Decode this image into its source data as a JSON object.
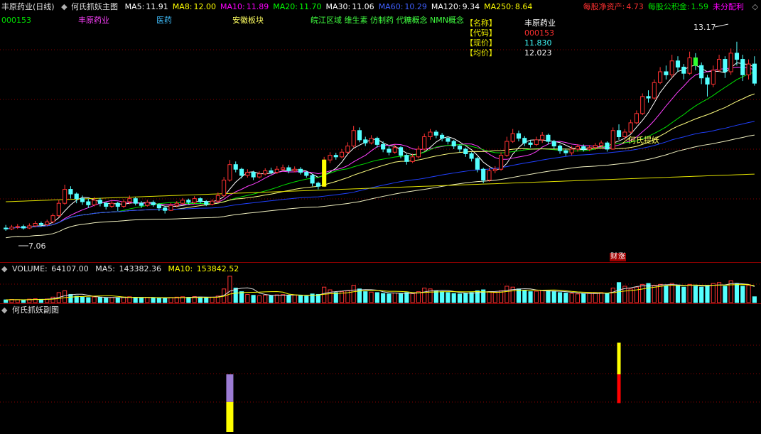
{
  "header": {
    "title": "丰原药业(日线)",
    "indicator_name": "何氏抓妖主图",
    "ma": [
      {
        "label": "MA5:",
        "value": "11.91",
        "color": "#ffffff"
      },
      {
        "label": "MA8:",
        "value": "12.00",
        "color": "#ffff00"
      },
      {
        "label": "MA10:",
        "value": "11.89",
        "color": "#ff00ff"
      },
      {
        "label": "MA20:",
        "value": "11.70",
        "color": "#00ff00"
      },
      {
        "label": "MA30:",
        "value": "11.06",
        "color": "#ffffff"
      },
      {
        "label": "MA60:",
        "value": "10.29",
        "color": "#4060ff"
      },
      {
        "label": "MA120:",
        "value": "9.34",
        "color": "#ffffff"
      },
      {
        "label": "MA250:",
        "value": "8.64",
        "color": "#ffff00"
      }
    ],
    "right": [
      {
        "label": "每股净资产:",
        "value": "4.73",
        "label_color": "#ff3030",
        "value_color": "#ff3030"
      },
      {
        "label": "每股公积金:",
        "value": "1.59",
        "label_color": "#00e000",
        "value_color": "#00e000"
      },
      {
        "label": "未分配利",
        "value": "",
        "label_color": "#ff00ff",
        "value_color": "#ff00ff"
      }
    ]
  },
  "subheader": {
    "code": "000153",
    "name": "丰原药业",
    "industry": "医药",
    "region": "安徽板块",
    "concepts": "皖江区域 维生素 仿制药 代糖概念 NMN概念"
  },
  "info_panel": [
    {
      "key": "【名称】",
      "value": "丰原药业",
      "color": "#ffffff"
    },
    {
      "key": "【代码】",
      "value": "000153",
      "color": "#ff3030"
    },
    {
      "key": "【现价】",
      "value": "11.830",
      "color": "#40ffff"
    },
    {
      "key": "【均价】",
      "value": "12.023",
      "color": "#ffffff"
    }
  ],
  "annotations": {
    "high_price": "13.17",
    "low_price": "7.06",
    "signal_text": "何氏提妖",
    "badge_cai": "财",
    "badge_zhang": "涨"
  },
  "volume_panel": {
    "title": "VOLUME:",
    "volume": "64107.00",
    "ma5_label": "MA5:",
    "ma5": "143382.36",
    "ma10_label": "MA10:",
    "ma10": "153842.52"
  },
  "sub_panel": {
    "title": "何氏抓妖副图"
  },
  "colors": {
    "up": "#ff3232",
    "down": "#54ffff",
    "background": "#000000",
    "grid": "#8b0000"
  },
  "chart_data": {
    "type": "candlestick",
    "price_range": [
      6.6,
      13.6
    ],
    "candles": [
      [
        7.15,
        7.12,
        7.25,
        7.06
      ],
      [
        7.12,
        7.18,
        7.25,
        7.08
      ],
      [
        7.18,
        7.2,
        7.28,
        7.12
      ],
      [
        7.2,
        7.15,
        7.26,
        7.1
      ],
      [
        7.15,
        7.22,
        7.3,
        7.12
      ],
      [
        7.22,
        7.3,
        7.38,
        7.18
      ],
      [
        7.3,
        7.26,
        7.36,
        7.2
      ],
      [
        7.26,
        7.35,
        7.42,
        7.22
      ],
      [
        7.35,
        7.55,
        7.62,
        7.3
      ],
      [
        7.55,
        7.95,
        8.05,
        7.5
      ],
      [
        7.95,
        8.4,
        8.55,
        7.9
      ],
      [
        8.4,
        8.25,
        8.5,
        8.1
      ],
      [
        8.25,
        8.1,
        8.3,
        7.95
      ],
      [
        8.1,
        8.0,
        8.2,
        7.9
      ],
      [
        8.0,
        7.9,
        8.1,
        7.8
      ],
      [
        7.9,
        8.05,
        8.15,
        7.85
      ],
      [
        8.05,
        7.95,
        8.12,
        7.85
      ],
      [
        7.95,
        7.85,
        8.0,
        7.75
      ],
      [
        7.85,
        7.95,
        8.05,
        7.8
      ],
      [
        7.95,
        7.85,
        8.0,
        7.7
      ],
      [
        7.85,
        8.0,
        8.08,
        7.8
      ],
      [
        8.0,
        8.1,
        8.2,
        7.92
      ],
      [
        8.1,
        7.95,
        8.15,
        7.88
      ],
      [
        7.95,
        7.88,
        8.02,
        7.8
      ],
      [
        7.88,
        7.98,
        8.06,
        7.84
      ],
      [
        7.98,
        7.9,
        8.04,
        7.84
      ],
      [
        7.9,
        7.8,
        7.95,
        7.7
      ],
      [
        7.8,
        7.72,
        7.85,
        7.62
      ],
      [
        7.72,
        7.88,
        7.96,
        7.7
      ],
      [
        7.88,
        7.95,
        8.02,
        7.82
      ],
      [
        7.95,
        8.05,
        8.12,
        7.9
      ],
      [
        8.05,
        7.98,
        8.1,
        7.9
      ],
      [
        7.98,
        8.1,
        8.18,
        7.92
      ],
      [
        8.1,
        8.0,
        8.15,
        7.94
      ],
      [
        8.0,
        7.92,
        8.05,
        7.86
      ],
      [
        7.92,
        8.02,
        8.08,
        7.88
      ],
      [
        8.02,
        8.2,
        8.3,
        7.98
      ],
      [
        8.2,
        8.7,
        8.8,
        8.15
      ],
      [
        8.7,
        9.2,
        9.35,
        8.65
      ],
      [
        9.2,
        9.05,
        9.3,
        8.95
      ],
      [
        9.05,
        8.85,
        9.1,
        8.75
      ],
      [
        8.85,
        8.95,
        9.05,
        8.78
      ],
      [
        8.95,
        8.8,
        9.0,
        8.7
      ],
      [
        8.8,
        8.9,
        8.98,
        8.75
      ],
      [
        8.9,
        9.0,
        9.08,
        8.85
      ],
      [
        9.0,
        8.95,
        9.1,
        8.88
      ],
      [
        8.95,
        9.05,
        9.15,
        8.9
      ],
      [
        9.05,
        9.1,
        9.2,
        9.0
      ],
      [
        9.1,
        9.0,
        9.18,
        8.92
      ],
      [
        9.0,
        9.05,
        9.14,
        8.95
      ],
      [
        9.05,
        8.95,
        9.12,
        8.88
      ],
      [
        8.95,
        8.85,
        9.0,
        8.78
      ],
      [
        8.85,
        8.6,
        8.9,
        8.5
      ],
      [
        8.6,
        8.5,
        8.65,
        8.4
      ],
      [
        8.5,
        9.35,
        9.45,
        8.48
      ],
      [
        9.35,
        9.5,
        9.6,
        9.25
      ],
      [
        9.5,
        9.45,
        9.58,
        9.36
      ],
      [
        9.45,
        9.6,
        9.7,
        9.4
      ],
      [
        9.6,
        9.8,
        9.92,
        9.55
      ],
      [
        9.8,
        10.3,
        10.45,
        9.75
      ],
      [
        10.3,
        10.0,
        10.4,
        9.92
      ],
      [
        10.0,
        9.9,
        10.1,
        9.8
      ],
      [
        9.9,
        10.05,
        10.15,
        9.85
      ],
      [
        10.05,
        9.85,
        10.1,
        9.75
      ],
      [
        9.85,
        9.7,
        9.95,
        9.6
      ],
      [
        9.7,
        9.6,
        9.8,
        9.5
      ],
      [
        9.6,
        9.75,
        9.85,
        9.55
      ],
      [
        9.75,
        9.5,
        9.8,
        9.4
      ],
      [
        9.5,
        9.3,
        9.55,
        9.2
      ],
      [
        9.3,
        9.45,
        9.55,
        9.25
      ],
      [
        9.45,
        9.7,
        9.8,
        9.4
      ],
      [
        9.7,
        10.1,
        10.2,
        9.65
      ],
      [
        10.1,
        10.25,
        10.35,
        10.0
      ],
      [
        10.25,
        10.15,
        10.32,
        10.05
      ],
      [
        10.15,
        10.05,
        10.22,
        9.95
      ],
      [
        10.05,
        9.95,
        10.1,
        9.85
      ],
      [
        9.95,
        9.8,
        10.0,
        9.7
      ],
      [
        9.8,
        9.7,
        9.85,
        9.6
      ],
      [
        9.7,
        9.55,
        9.75,
        9.45
      ],
      [
        9.55,
        9.4,
        9.6,
        9.3
      ],
      [
        9.4,
        9.05,
        9.45,
        8.95
      ],
      [
        9.05,
        8.7,
        9.1,
        8.6
      ],
      [
        8.7,
        9.0,
        9.1,
        8.65
      ],
      [
        9.0,
        9.05,
        9.15,
        8.92
      ],
      [
        9.05,
        9.5,
        9.6,
        9.0
      ],
      [
        9.5,
        9.95,
        10.1,
        9.45
      ],
      [
        9.95,
        10.2,
        10.35,
        9.9
      ],
      [
        10.2,
        10.05,
        10.3,
        9.95
      ],
      [
        10.05,
        9.9,
        10.12,
        9.8
      ],
      [
        9.9,
        9.85,
        9.98,
        9.75
      ],
      [
        9.85,
        10.0,
        10.1,
        9.8
      ],
      [
        10.0,
        10.15,
        10.25,
        9.9
      ],
      [
        10.15,
        9.95,
        10.2,
        9.85
      ],
      [
        9.95,
        9.8,
        10.0,
        9.7
      ],
      [
        9.8,
        9.65,
        9.85,
        9.55
      ],
      [
        9.65,
        9.58,
        9.72,
        9.48
      ],
      [
        9.58,
        9.7,
        9.8,
        9.5
      ],
      [
        9.7,
        9.78,
        9.86,
        9.62
      ],
      [
        9.78,
        9.7,
        9.85,
        9.62
      ],
      [
        9.7,
        9.75,
        9.83,
        9.64
      ],
      [
        9.75,
        9.82,
        9.9,
        9.68
      ],
      [
        9.82,
        9.9,
        9.98,
        9.75
      ],
      [
        9.9,
        9.7,
        9.95,
        9.62
      ],
      [
        9.7,
        10.3,
        10.4,
        9.68
      ],
      [
        10.3,
        10.1,
        10.5,
        10.0
      ],
      [
        10.1,
        10.25,
        10.35,
        10.0
      ],
      [
        10.25,
        10.55,
        10.65,
        10.2
      ],
      [
        10.55,
        10.85,
        10.95,
        10.5
      ],
      [
        10.85,
        11.4,
        11.5,
        10.8
      ],
      [
        11.4,
        11.35,
        11.6,
        11.2
      ],
      [
        11.35,
        11.85,
        11.95,
        11.3
      ],
      [
        11.85,
        12.2,
        12.35,
        11.8
      ],
      [
        12.2,
        12.1,
        12.4,
        11.95
      ],
      [
        12.1,
        12.55,
        12.75,
        12.0
      ],
      [
        12.55,
        12.35,
        12.7,
        12.2
      ],
      [
        12.35,
        12.15,
        12.45,
        11.95
      ],
      [
        12.15,
        12.65,
        12.85,
        12.1
      ],
      [
        12.65,
        12.4,
        12.8,
        12.25
      ],
      [
        12.4,
        12.0,
        12.5,
        11.8
      ],
      [
        12.0,
        11.8,
        12.1,
        11.4
      ],
      [
        11.8,
        12.25,
        12.4,
        11.7
      ],
      [
        12.25,
        12.6,
        12.75,
        12.2
      ],
      [
        12.6,
        12.2,
        12.7,
        12.0
      ],
      [
        12.2,
        12.8,
        12.95,
        12.1
      ],
      [
        12.8,
        12.6,
        13.17,
        12.4
      ],
      [
        12.6,
        12.1,
        12.75,
        11.9
      ],
      [
        12.1,
        12.45,
        12.6,
        11.95
      ],
      [
        12.45,
        11.83,
        12.7,
        11.75
      ]
    ],
    "volume_range": [
      0,
      320000
    ],
    "volumes": [
      30000,
      35000,
      32000,
      28000,
      38000,
      42000,
      36000,
      40000,
      60000,
      110000,
      130000,
      90000,
      70000,
      60000,
      55000,
      62000,
      58000,
      50000,
      56000,
      52000,
      60000,
      64000,
      55000,
      50000,
      58000,
      54000,
      48000,
      45000,
      56000,
      60000,
      64000,
      58000,
      66000,
      60000,
      54000,
      60000,
      72000,
      150000,
      290000,
      160000,
      120000,
      90000,
      80000,
      75000,
      82000,
      78000,
      85000,
      88000,
      80000,
      84000,
      78000,
      70000,
      95000,
      90000,
      170000,
      140000,
      110000,
      120000,
      130000,
      190000,
      150000,
      120000,
      115000,
      110000,
      100000,
      95000,
      105000,
      100000,
      110000,
      98000,
      120000,
      160000,
      150000,
      130000,
      120000,
      110000,
      100000,
      95000,
      100000,
      110000,
      130000,
      140000,
      120000,
      110000,
      130000,
      180000,
      170000,
      150000,
      130000,
      120000,
      125000,
      135000,
      130000,
      120000,
      110000,
      105000,
      100000,
      95000,
      98000,
      102000,
      105000,
      110000,
      100000,
      160000,
      220000,
      180000,
      150000,
      170000,
      200000,
      210000,
      190000,
      200000,
      180000,
      210000,
      190000,
      170000,
      200000,
      180000,
      170000,
      190000,
      210000,
      220000,
      180000,
      240000,
      210000,
      180000,
      190000,
      64107
    ],
    "sub_signals": [
      {
        "index": 38,
        "value": 1.0,
        "split": 0.52,
        "top_color": "#9c7cd4",
        "bottom_color": "#ffff00"
      },
      {
        "index": 104,
        "value": 1.55,
        "split": 1.0,
        "top_color": "#ffff00",
        "bottom_color": "#ff0000"
      }
    ],
    "sub_range": [
      0,
      2
    ]
  }
}
